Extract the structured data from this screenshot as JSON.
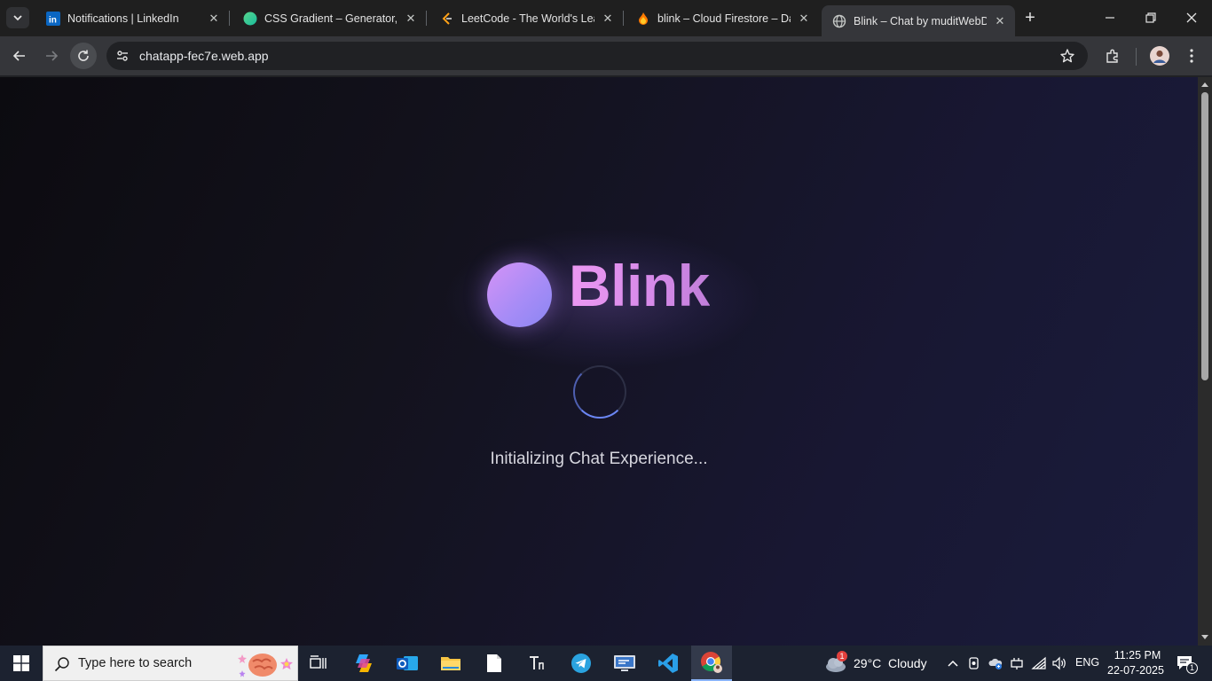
{
  "browser": {
    "tabs": [
      {
        "title": "Notifications | LinkedIn",
        "icon": "linkedin-icon"
      },
      {
        "title": "CSS Gradient – Generator, M",
        "icon": "css-gradient-icon"
      },
      {
        "title": "LeetCode - The World's Leac",
        "icon": "leetcode-icon"
      },
      {
        "title": "blink – Cloud Firestore – Dat",
        "icon": "firebase-icon"
      },
      {
        "title": "Blink – Chat by muditWebDe",
        "icon": "globe-icon",
        "active": true
      }
    ],
    "url": "chatapp-fec7e.web.app"
  },
  "page": {
    "logo_text": "Blink",
    "status_text": "Initializing Chat Experience...",
    "colors": {
      "logo_gradient_start": "#d593f6",
      "logo_gradient_end": "#8a86f3",
      "logo_text": "#da8cf0",
      "spinner_accent": "#6b86f3",
      "background": "#13121d"
    }
  },
  "taskbar": {
    "search_placeholder": "Type here to search",
    "weather": {
      "temp": "29°C",
      "condition": "Cloudy",
      "badge": "1"
    },
    "language": "ENG",
    "time": "11:25 PM",
    "date": "22-07-2025",
    "notification_count": "1"
  }
}
